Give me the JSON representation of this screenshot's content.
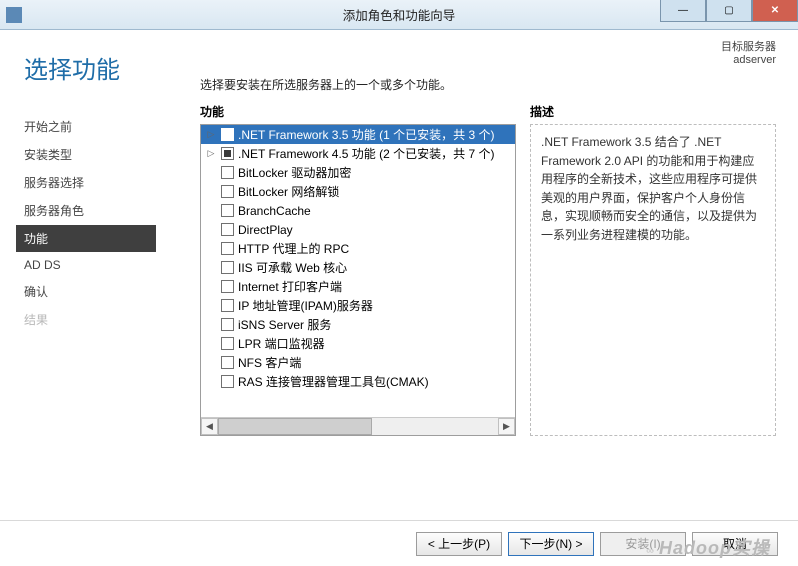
{
  "window": {
    "title": "添加角色和功能向导",
    "target_label": "目标服务器",
    "target_name": "adserver"
  },
  "page_heading": "选择功能",
  "nav": [
    {
      "label": "开始之前",
      "state": "normal"
    },
    {
      "label": "安装类型",
      "state": "normal"
    },
    {
      "label": "服务器选择",
      "state": "normal"
    },
    {
      "label": "服务器角色",
      "state": "normal"
    },
    {
      "label": "功能",
      "state": "active"
    },
    {
      "label": "AD DS",
      "state": "normal"
    },
    {
      "label": "确认",
      "state": "normal"
    },
    {
      "label": "结果",
      "state": "disabled"
    }
  ],
  "instruction": "选择要安装在所选服务器上的一个或多个功能。",
  "labels": {
    "features": "功能",
    "description": "描述"
  },
  "features": [
    {
      "expandable": true,
      "check": "partial",
      "label": ".NET Framework 3.5 功能 (1 个已安装，共 3 个)",
      "selected": true
    },
    {
      "expandable": true,
      "check": "partial",
      "label": ".NET Framework 4.5 功能 (2 个已安装，共 7 个)"
    },
    {
      "expandable": false,
      "check": "empty",
      "label": "BitLocker 驱动器加密"
    },
    {
      "expandable": false,
      "check": "empty",
      "label": "BitLocker 网络解锁"
    },
    {
      "expandable": false,
      "check": "empty",
      "label": "BranchCache"
    },
    {
      "expandable": false,
      "check": "empty",
      "label": "DirectPlay"
    },
    {
      "expandable": false,
      "check": "empty",
      "label": "HTTP 代理上的 RPC"
    },
    {
      "expandable": false,
      "check": "empty",
      "label": "IIS 可承载 Web 核心"
    },
    {
      "expandable": false,
      "check": "empty",
      "label": "Internet 打印客户端"
    },
    {
      "expandable": false,
      "check": "empty",
      "label": "IP 地址管理(IPAM)服务器"
    },
    {
      "expandable": false,
      "check": "empty",
      "label": "iSNS Server 服务"
    },
    {
      "expandable": false,
      "check": "empty",
      "label": "LPR 端口监视器"
    },
    {
      "expandable": false,
      "check": "empty",
      "label": "NFS 客户端"
    },
    {
      "expandable": false,
      "check": "empty",
      "label": "RAS 连接管理器管理工具包(CMAK)"
    }
  ],
  "description": ".NET Framework 3.5 结合了 .NET Framework 2.0 API 的功能和用于构建应用程序的全新技术，这些应用程序可提供美观的用户界面，保护客户个人身份信息，实现顺畅而安全的通信，以及提供为一系列业务进程建模的功能。",
  "buttons": {
    "prev": "< 上一步(P)",
    "next": "下一步(N) >",
    "install": "安装(I)",
    "cancel": "取消"
  },
  "watermark": {
    "small": "∞",
    "text": "Hadoop实操"
  }
}
